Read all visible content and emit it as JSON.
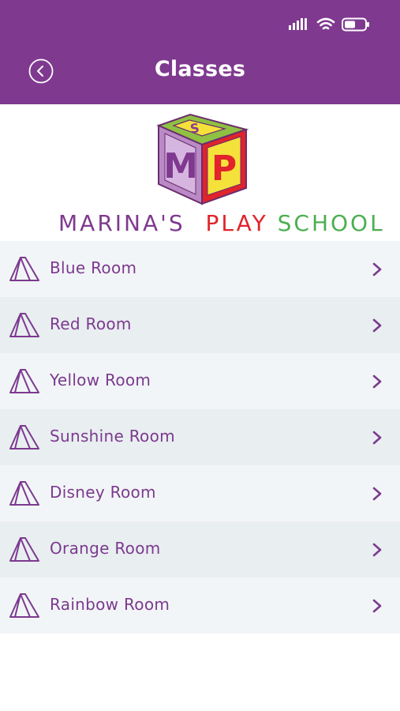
{
  "header": {
    "title": "Classes",
    "background": "#7f398f",
    "back_icon": "back-circle-icon"
  },
  "status_bar": {
    "icons": [
      "signal-icon",
      "wifi-icon",
      "battery-icon"
    ]
  },
  "logo": {
    "block_letters": {
      "top": "S",
      "left": "M",
      "right": "P"
    },
    "wordmark_part1": "MARINA'S",
    "wordmark_part2": "PLAY",
    "wordmark_part3": "SCHOOL"
  },
  "classes": [
    {
      "label": "Blue Room"
    },
    {
      "label": "Red Room"
    },
    {
      "label": "Yellow Room"
    },
    {
      "label": "Sunshine Room"
    },
    {
      "label": "Disney Room"
    },
    {
      "label": "Orange Room"
    },
    {
      "label": "Rainbow Room"
    }
  ],
  "colors": {
    "accent": "#7f398f",
    "row_light": "#f2f5f7",
    "row_dark": "#e9eef1",
    "text": "#7b3a8e"
  }
}
